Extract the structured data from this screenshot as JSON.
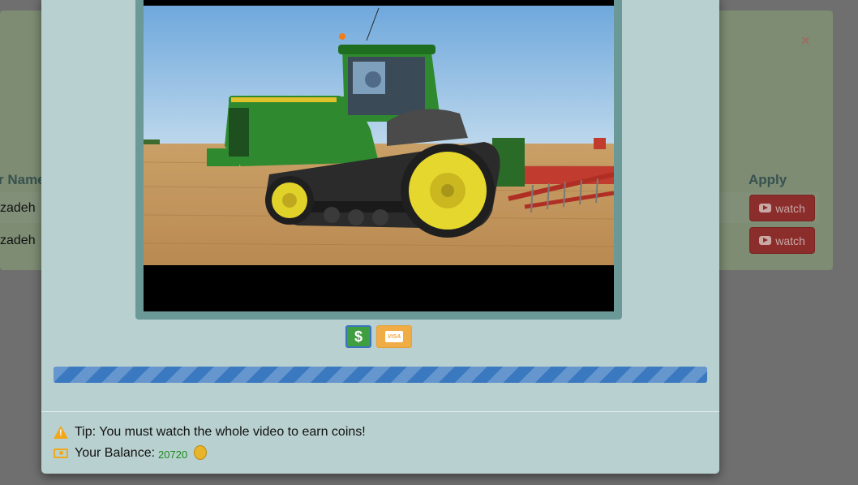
{
  "background": {
    "close_symbol": "×",
    "col_name_header": "r Name",
    "col_apply_header": "Apply",
    "rows": [
      {
        "name": "zadeh",
        "action": "watch"
      },
      {
        "name": "zadeh",
        "action": "watch"
      }
    ]
  },
  "modal": {
    "video_icon": "tractor-video-frame",
    "payment": {
      "dollar_label": "$",
      "visa_label": "VISA"
    },
    "progress_percent": 100,
    "tip_text": "Tip: You must watch the whole video to earn coins!",
    "balance_label": "Your Balance:",
    "balance_value": "20720"
  },
  "colors": {
    "watch_button": "#8a2d2b",
    "progress": "#3a78c0",
    "balance_value": "#1a8a1a",
    "warning": "#f0a81a"
  }
}
